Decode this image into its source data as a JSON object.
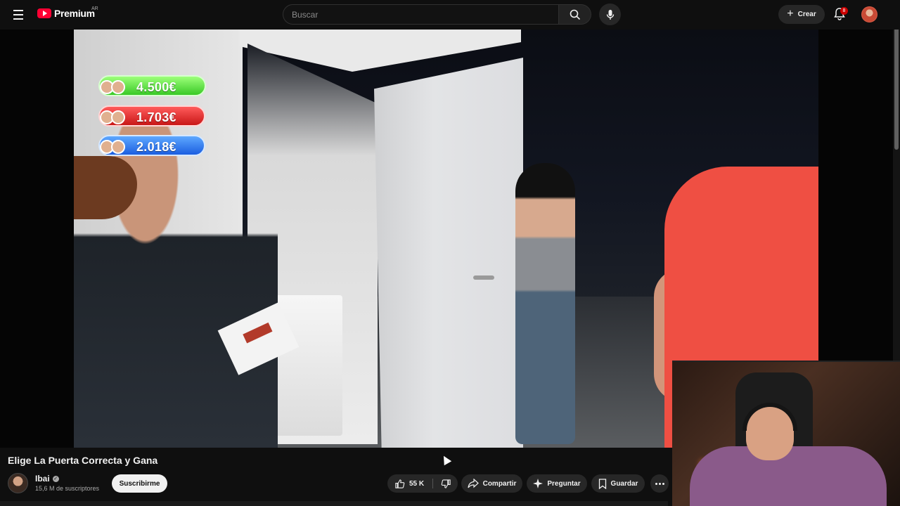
{
  "header": {
    "brand": "Premium",
    "region": "AR",
    "search_placeholder": "Buscar",
    "create_label": "Crear",
    "notifications_count": "8"
  },
  "video": {
    "scores": [
      {
        "value": "4.500€",
        "color": "#39c926"
      },
      {
        "value": "1.703€",
        "color": "#c91717"
      },
      {
        "value": "2.018€",
        "color": "#1b5ee0"
      }
    ]
  },
  "details": {
    "title": "Elige La Puerta Correcta y Gana",
    "channel_name": "Ibai",
    "subscribers": "15,6 M de suscriptores",
    "subscribe_label": "Suscribirme",
    "likes": "55 K",
    "share_label": "Compartir",
    "ask_label": "Preguntar",
    "save_label": "Guardar"
  },
  "icons": [
    "menu-icon",
    "youtube-logo-icon",
    "search-icon",
    "mic-icon",
    "plus-icon",
    "bell-icon",
    "like-icon",
    "dislike-icon",
    "share-icon",
    "sparkle-icon",
    "bookmark-icon",
    "more-icon",
    "verified-icon"
  ],
  "colors": {
    "brand_red": "#ff0033",
    "background": "#0f0f0f",
    "pill": "#272727"
  }
}
